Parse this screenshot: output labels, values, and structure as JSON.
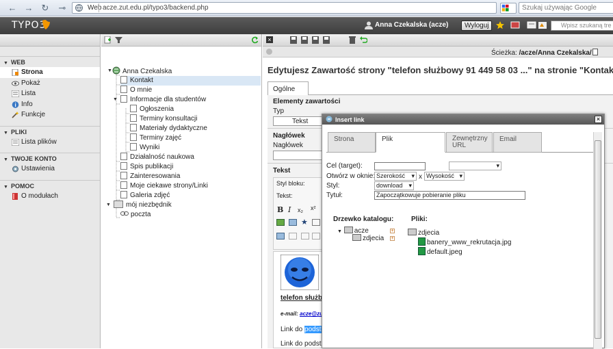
{
  "browser": {
    "url_label": "Web",
    "url": "acze.zut.edu.pl/typo3/backend.php",
    "search_placeholder": "Szukaj używając Google"
  },
  "header": {
    "logo": "TYPO3",
    "user": "Anna Czekalska (acze)",
    "logout": "Wyloguj",
    "search_placeholder": "Wpisz szukaną tre"
  },
  "modmenu": {
    "sections": [
      {
        "title": "WEB",
        "items": [
          "Strona",
          "Pokaż",
          "Lista",
          "Info",
          "Funkcje"
        ]
      },
      {
        "title": "PLIKI",
        "items": [
          "Lista plików"
        ]
      },
      {
        "title": "TWOJE KONTO",
        "items": [
          "Ustawienia"
        ]
      },
      {
        "title": "POMOC",
        "items": [
          "O modułach"
        ]
      }
    ],
    "active": "Strona"
  },
  "tree": {
    "root": "Anna Czekalska",
    "items": [
      "Kontakt",
      "O mnie",
      "Informacje dla studentów",
      "Ogłoszenia",
      "Terminy konsultacji",
      "Materiały dydaktyczne",
      "Terminy zajęć",
      "Wyniki",
      "Działalność naukowa",
      "Spis publikacji",
      "Zainteresowania",
      "Moje ciekawe strony/Linki",
      "Galeria zdjęć",
      "mój niezbędnik",
      "poczta"
    ]
  },
  "content": {
    "path_label": "Ścieżka:",
    "path_value": "/acze/Anna Czekalska/",
    "title": "Edytujesz Zawartość strony \"telefon służbowy 91 449 58 03 ...\" na stronie \"Kontakt\"",
    "tab": "Ogólne",
    "section_elements": "Elementy zawartości",
    "type_label": "Typ",
    "type_value": "Tekst",
    "header_section": "Nagłówek",
    "header_label": "Nagłówek",
    "text_section": "Tekst",
    "block_style": "Styl bloku:",
    "text_label": "Tekst:",
    "rte_line1": "telefon służbow",
    "rte_email_label": "e-mail:",
    "rte_email": "acze@zu",
    "rte_link1_prefix": "Link do",
    "rte_link1_sel": "podstr",
    "rte_link2": "Link do podstr"
  },
  "dialog": {
    "title": "Insert link",
    "tabs": [
      "Strona",
      "Plik",
      "Zewnętrzny URL",
      "Email"
    ],
    "active_tab": "Plik",
    "target_label": "Cel (target):",
    "open_label": "Otwórz w oknie:",
    "width_value": "Szerokość",
    "x": "x",
    "height_value": "Wysokość",
    "style_label": "Styl:",
    "style_value": "download",
    "title_label": "Tytuł:",
    "title_value": "Zapoczątkowuje pobieranie pliku",
    "dir_tree_label": "Drzewko katalogu:",
    "files_label": "Pliki:",
    "dir_root": "acze",
    "dir_child": "zdjecia",
    "files_folder": "zdjecia",
    "files": [
      "banery_www_rekrutacja.jpg",
      "default.jpeg"
    ]
  },
  "colors": {
    "header": "#4a4a4a",
    "accent": "#f49700",
    "selection": "#3399ff"
  }
}
